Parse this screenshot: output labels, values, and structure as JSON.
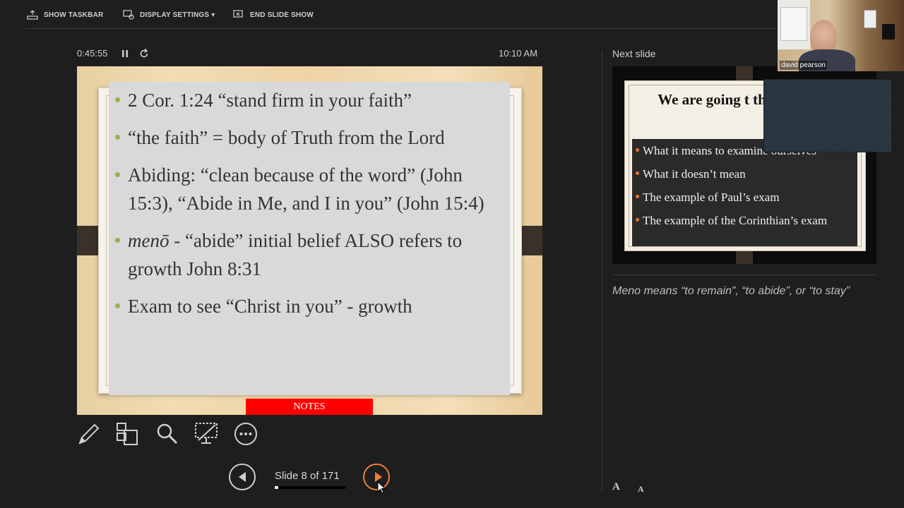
{
  "toolbar": {
    "show_taskbar": "SHOW TASKBAR",
    "display_settings": "DISPLAY SETTINGS ▾",
    "end_slide_show": "END SLIDE SHOW"
  },
  "timer": {
    "elapsed": "0:45:55",
    "clock": "10:10 AM"
  },
  "current_slide": {
    "bullets": [
      "2 Cor. 1:24 “stand firm in your faith”",
      "“the faith” = body of Truth from the Lord",
      "Abiding: “clean because of the word” (John 15:3), “Abide in Me, and I in you” (John 15:4)",
      "menō",
      " - “abide” initial belief ALSO refers to growth John 8:31",
      "Exam to see “Christ in you” - growth"
    ],
    "notes_button": "NOTES",
    "accent_color": "#94b34a"
  },
  "navigation": {
    "counter": "Slide 8 of 171",
    "current": 8,
    "total": 171,
    "accent_color": "#f07d3a"
  },
  "next_panel": {
    "label": "Next slide",
    "title": "We are going t this doctrine",
    "bullets": [
      "What it means to examine ourselves",
      "What it doesn’t mean",
      "The example of Paul’s exam",
      "The example of the Corinthian’s exam"
    ]
  },
  "notes_text": "Meno means “to remain”, “to abide”, or “to stay”",
  "font_controls": {
    "increase": "A",
    "decrease": "A"
  },
  "webcam": {
    "name": "david pearson"
  }
}
